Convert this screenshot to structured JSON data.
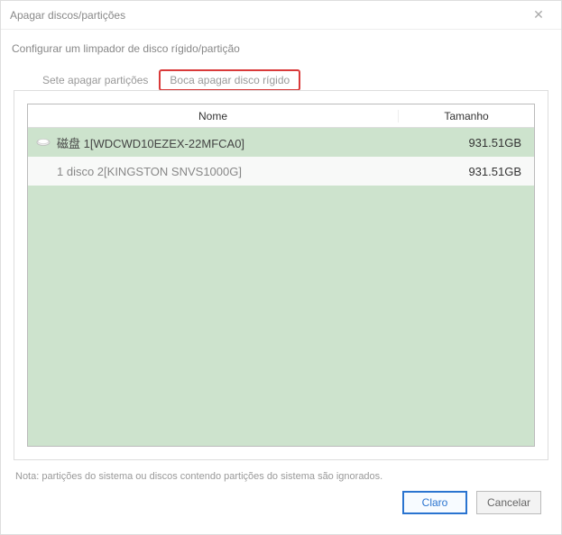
{
  "window": {
    "title": "Apagar discos/partições"
  },
  "subtitle": "Configurar um limpador de disco rígido/partição",
  "tabs": {
    "partitions": "Sete apagar partições",
    "disk": "Boca apagar disco rígido"
  },
  "table": {
    "headers": {
      "name": "Nome",
      "size": "Tamanho"
    },
    "rows": [
      {
        "icon": "disk",
        "name": "磁盘 1[WDCWD10EZEX-22MFCA0]",
        "size": "931.51GB",
        "selected": true
      },
      {
        "icon": "none",
        "name": "1 disco 2[KINGSTON SNVS1000G]",
        "size": "931.51GB",
        "selected": false
      }
    ]
  },
  "note": "Nota: partições do sistema ou discos contendo partições do sistema são ignorados.",
  "buttons": {
    "ok": "Claro",
    "cancel": "Cancelar"
  }
}
